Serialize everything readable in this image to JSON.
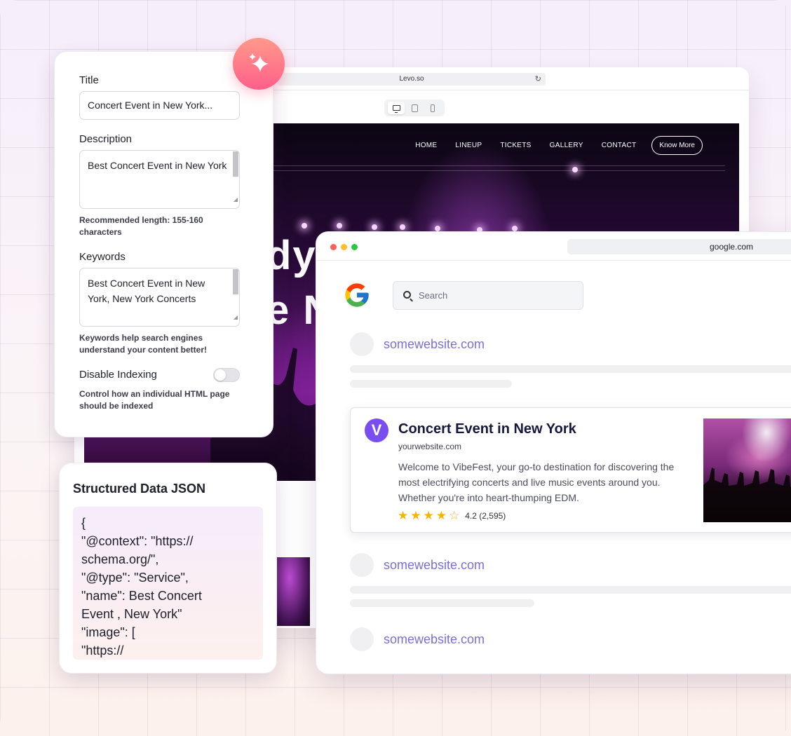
{
  "levo": {
    "url": "Levo.so",
    "nav": [
      "HOME",
      "LINEUP",
      "TICKETS",
      "GALLERY",
      "CONTACT"
    ],
    "cta": "Know More",
    "hero_lines": [
      "dy",
      "e N"
    ]
  },
  "seo": {
    "title_label": "Title",
    "title_value": "Concert Event in New York...",
    "description_label": "Description",
    "description_value": "Best Concert Event in New York",
    "description_help": "Recommended length: 155-160 characters",
    "keywords_label": "Keywords",
    "keywords_value": "Best Concert Event in New York, New York Concerts",
    "keywords_help": "Keywords help search engines understand your content better!",
    "indexing_label": "Disable Indexing",
    "indexing_help": "Control how an individual HTML page should be indexed",
    "indexing_enabled": false
  },
  "json_card": {
    "title": "Structured Data JSON",
    "lines": [
      "{",
      "      \"@context\": \"https://",
      "schema.org/\",",
      "      \"@type\": \"Service\",",
      "      \"name\": Best Concert",
      "Event , New York\"",
      "      \"image\": [",
      "        \"https://"
    ]
  },
  "google": {
    "url": "google.com",
    "search_placeholder": "Search",
    "sites": [
      "somewebsite.com",
      "somewebsite.com",
      "somewebsite.com"
    ],
    "result": {
      "avatar_letter": "V",
      "title": "Concert Event in New York",
      "domain": "yourwebsite.com",
      "description": "Welcome to VibeFest, your go-to destination for discovering the most electrifying concerts and live music events around you. Whether you're into heart-thumping EDM.",
      "rating": 4.2,
      "rating_text": "4.2 (2,595)"
    }
  },
  "colors": {
    "accent": "#7a4df0",
    "link": "#7b6fd6",
    "badge_top": "#ff9a8a",
    "badge_bottom": "#ff5e8a",
    "star": "#f7b500"
  },
  "icons": [
    "sparkle-icon",
    "reload-icon",
    "desktop-icon",
    "tablet-icon",
    "phone-icon",
    "google-logo-icon",
    "search-icon",
    "star-icon"
  ]
}
